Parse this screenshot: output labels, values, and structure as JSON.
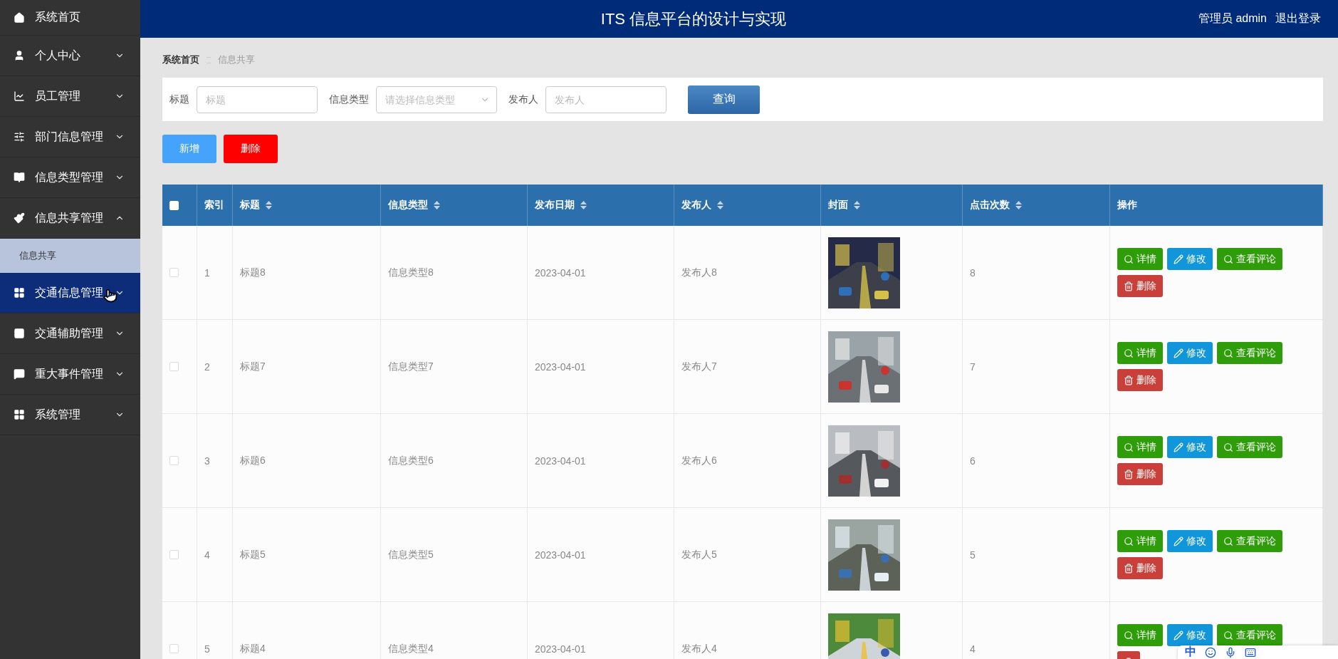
{
  "header": {
    "title": "ITS 信息平台的设计与实现",
    "user": "管理员 admin",
    "logout": "退出登录"
  },
  "sidebar": {
    "items": [
      {
        "label": "系统首页",
        "selected": false
      },
      {
        "label": "个人中心",
        "selected": false,
        "expanded": false
      },
      {
        "label": "员工管理",
        "selected": false,
        "expanded": false
      },
      {
        "label": "部门信息管理",
        "selected": false,
        "expanded": false
      },
      {
        "label": "信息类型管理",
        "selected": false,
        "expanded": false
      },
      {
        "label": "信息共享管理",
        "selected": false,
        "expanded": true,
        "children": [
          {
            "label": "信息共享",
            "selected": true
          }
        ]
      },
      {
        "label": "交通信息管理",
        "selected": true,
        "expanded": false
      },
      {
        "label": "交通辅助管理",
        "selected": false,
        "expanded": false
      },
      {
        "label": "重大事件管理",
        "selected": false,
        "expanded": false
      },
      {
        "label": "系统管理",
        "selected": false,
        "expanded": false
      }
    ]
  },
  "breadcrumb": [
    "系统首页",
    "信息共享"
  ],
  "search": {
    "fields": [
      {
        "label": "标题",
        "kind": "text",
        "placeholder": "标题"
      },
      {
        "label": "信息类型",
        "kind": "select",
        "placeholder": "请选择信息类型"
      },
      {
        "label": "发布人",
        "kind": "text",
        "placeholder": "发布人"
      }
    ],
    "button": "查询"
  },
  "toolbar": [
    {
      "label": "新增",
      "kind": "add"
    },
    {
      "label": "删除",
      "kind": "delete"
    }
  ],
  "table": {
    "header_checked": false,
    "columns": [
      {
        "label": "索引"
      },
      {
        "label": "标题",
        "sortable": true
      },
      {
        "label": "信息类型",
        "sortable": true
      },
      {
        "label": "发布日期",
        "sortable": true
      },
      {
        "label": "发布人",
        "sortable": true
      },
      {
        "label": "封面",
        "sortable": true
      },
      {
        "label": "点击次数",
        "sortable": true
      },
      {
        "label": "操作"
      }
    ],
    "rows": [
      {
        "checked": false,
        "index": "1",
        "title": "标题8",
        "type": "信息类型8",
        "date": "2023-04-01",
        "publisher": "发布人8",
        "cover": {
          "kind": "picture"
        },
        "clicks": "8",
        "actions": [
          {
            "label": "详情",
            "kind": "detail"
          },
          {
            "label": "修改",
            "kind": "edit"
          },
          {
            "label": "查看评论",
            "kind": "comments"
          },
          {
            "label": "删除",
            "kind": "delete"
          }
        ]
      },
      {
        "checked": false,
        "index": "2",
        "title": "标题7",
        "type": "信息类型7",
        "date": "2023-04-01",
        "publisher": "发布人7",
        "cover": {
          "kind": "picture"
        },
        "clicks": "7",
        "actions": [
          {
            "label": "详情",
            "kind": "detail"
          },
          {
            "label": "修改",
            "kind": "edit"
          },
          {
            "label": "查看评论",
            "kind": "comments"
          },
          {
            "label": "删除",
            "kind": "delete"
          }
        ]
      },
      {
        "checked": false,
        "index": "3",
        "title": "标题6",
        "type": "信息类型6",
        "date": "2023-04-01",
        "publisher": "发布人6",
        "cover": {
          "kind": "picture"
        },
        "clicks": "6",
        "actions": [
          {
            "label": "详情",
            "kind": "detail"
          },
          {
            "label": "修改",
            "kind": "edit"
          },
          {
            "label": "查看评论",
            "kind": "comments"
          },
          {
            "label": "删除",
            "kind": "delete"
          }
        ]
      },
      {
        "checked": false,
        "index": "4",
        "title": "标题5",
        "type": "信息类型5",
        "date": "2023-04-01",
        "publisher": "发布人5",
        "cover": {
          "kind": "picture"
        },
        "clicks": "5",
        "actions": [
          {
            "label": "详情",
            "kind": "detail"
          },
          {
            "label": "修改",
            "kind": "edit"
          },
          {
            "label": "查看评论",
            "kind": "comments"
          },
          {
            "label": "删除",
            "kind": "delete"
          }
        ]
      },
      {
        "checked": false,
        "index": "5",
        "title": "标题4",
        "type": "信息类型4",
        "date": "2023-04-01",
        "publisher": "发布人4",
        "cover": {
          "kind": "picture"
        },
        "clicks": "4",
        "actions": [
          {
            "label": "详情",
            "kind": "detail"
          },
          {
            "label": "修改",
            "kind": "edit"
          },
          {
            "label": "查看评论",
            "kind": "comments"
          },
          {
            "kind": "delete"
          }
        ]
      }
    ]
  },
  "ime_toolbar": {
    "mode": "中"
  }
}
